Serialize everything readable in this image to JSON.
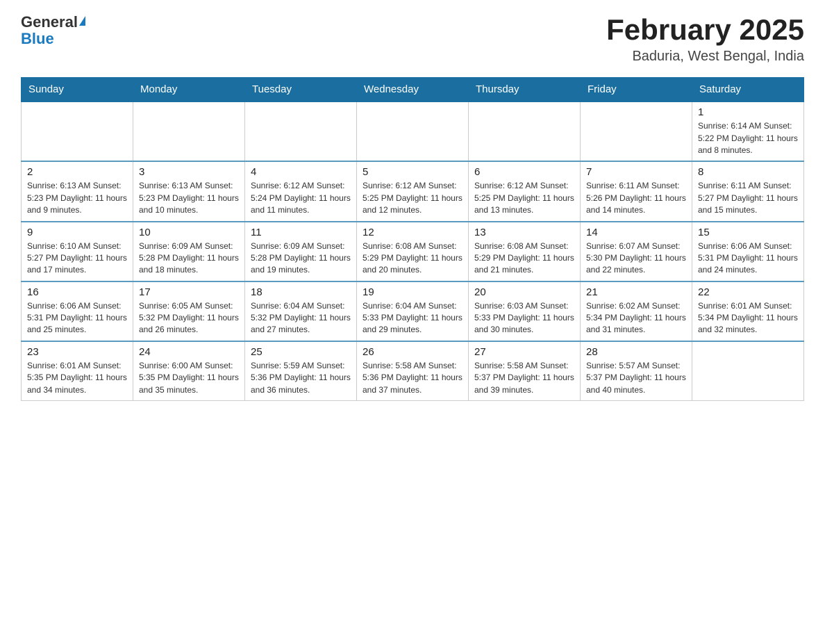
{
  "logo": {
    "general": "General",
    "blue": "Blue"
  },
  "title": "February 2025",
  "subtitle": "Baduria, West Bengal, India",
  "weekdays": [
    "Sunday",
    "Monday",
    "Tuesday",
    "Wednesday",
    "Thursday",
    "Friday",
    "Saturday"
  ],
  "weeks": [
    [
      {
        "day": "",
        "info": ""
      },
      {
        "day": "",
        "info": ""
      },
      {
        "day": "",
        "info": ""
      },
      {
        "day": "",
        "info": ""
      },
      {
        "day": "",
        "info": ""
      },
      {
        "day": "",
        "info": ""
      },
      {
        "day": "1",
        "info": "Sunrise: 6:14 AM\nSunset: 5:22 PM\nDaylight: 11 hours and 8 minutes."
      }
    ],
    [
      {
        "day": "2",
        "info": "Sunrise: 6:13 AM\nSunset: 5:23 PM\nDaylight: 11 hours and 9 minutes."
      },
      {
        "day": "3",
        "info": "Sunrise: 6:13 AM\nSunset: 5:23 PM\nDaylight: 11 hours and 10 minutes."
      },
      {
        "day": "4",
        "info": "Sunrise: 6:12 AM\nSunset: 5:24 PM\nDaylight: 11 hours and 11 minutes."
      },
      {
        "day": "5",
        "info": "Sunrise: 6:12 AM\nSunset: 5:25 PM\nDaylight: 11 hours and 12 minutes."
      },
      {
        "day": "6",
        "info": "Sunrise: 6:12 AM\nSunset: 5:25 PM\nDaylight: 11 hours and 13 minutes."
      },
      {
        "day": "7",
        "info": "Sunrise: 6:11 AM\nSunset: 5:26 PM\nDaylight: 11 hours and 14 minutes."
      },
      {
        "day": "8",
        "info": "Sunrise: 6:11 AM\nSunset: 5:27 PM\nDaylight: 11 hours and 15 minutes."
      }
    ],
    [
      {
        "day": "9",
        "info": "Sunrise: 6:10 AM\nSunset: 5:27 PM\nDaylight: 11 hours and 17 minutes."
      },
      {
        "day": "10",
        "info": "Sunrise: 6:09 AM\nSunset: 5:28 PM\nDaylight: 11 hours and 18 minutes."
      },
      {
        "day": "11",
        "info": "Sunrise: 6:09 AM\nSunset: 5:28 PM\nDaylight: 11 hours and 19 minutes."
      },
      {
        "day": "12",
        "info": "Sunrise: 6:08 AM\nSunset: 5:29 PM\nDaylight: 11 hours and 20 minutes."
      },
      {
        "day": "13",
        "info": "Sunrise: 6:08 AM\nSunset: 5:29 PM\nDaylight: 11 hours and 21 minutes."
      },
      {
        "day": "14",
        "info": "Sunrise: 6:07 AM\nSunset: 5:30 PM\nDaylight: 11 hours and 22 minutes."
      },
      {
        "day": "15",
        "info": "Sunrise: 6:06 AM\nSunset: 5:31 PM\nDaylight: 11 hours and 24 minutes."
      }
    ],
    [
      {
        "day": "16",
        "info": "Sunrise: 6:06 AM\nSunset: 5:31 PM\nDaylight: 11 hours and 25 minutes."
      },
      {
        "day": "17",
        "info": "Sunrise: 6:05 AM\nSunset: 5:32 PM\nDaylight: 11 hours and 26 minutes."
      },
      {
        "day": "18",
        "info": "Sunrise: 6:04 AM\nSunset: 5:32 PM\nDaylight: 11 hours and 27 minutes."
      },
      {
        "day": "19",
        "info": "Sunrise: 6:04 AM\nSunset: 5:33 PM\nDaylight: 11 hours and 29 minutes."
      },
      {
        "day": "20",
        "info": "Sunrise: 6:03 AM\nSunset: 5:33 PM\nDaylight: 11 hours and 30 minutes."
      },
      {
        "day": "21",
        "info": "Sunrise: 6:02 AM\nSunset: 5:34 PM\nDaylight: 11 hours and 31 minutes."
      },
      {
        "day": "22",
        "info": "Sunrise: 6:01 AM\nSunset: 5:34 PM\nDaylight: 11 hours and 32 minutes."
      }
    ],
    [
      {
        "day": "23",
        "info": "Sunrise: 6:01 AM\nSunset: 5:35 PM\nDaylight: 11 hours and 34 minutes."
      },
      {
        "day": "24",
        "info": "Sunrise: 6:00 AM\nSunset: 5:35 PM\nDaylight: 11 hours and 35 minutes."
      },
      {
        "day": "25",
        "info": "Sunrise: 5:59 AM\nSunset: 5:36 PM\nDaylight: 11 hours and 36 minutes."
      },
      {
        "day": "26",
        "info": "Sunrise: 5:58 AM\nSunset: 5:36 PM\nDaylight: 11 hours and 37 minutes."
      },
      {
        "day": "27",
        "info": "Sunrise: 5:58 AM\nSunset: 5:37 PM\nDaylight: 11 hours and 39 minutes."
      },
      {
        "day": "28",
        "info": "Sunrise: 5:57 AM\nSunset: 5:37 PM\nDaylight: 11 hours and 40 minutes."
      },
      {
        "day": "",
        "info": ""
      }
    ]
  ]
}
